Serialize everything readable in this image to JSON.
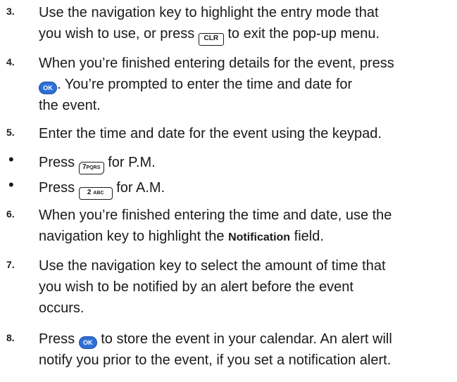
{
  "steps": [
    {
      "number": "3.",
      "line1": "Use the navigation key to highlight the entry mode that",
      "line2_pre": "you wish to use, or press ",
      "line2_key": "CLR",
      "line2_post": " to exit the pop-up menu."
    },
    {
      "number": "4.",
      "line1": "When you’re finished entering details for the event, press",
      "line2_key": "OK",
      "line2_post": ". You’re prompted to enter the time and date for",
      "line3": "the event."
    },
    {
      "number": "5.",
      "line1": "Enter the time and date for the event using the keypad."
    },
    {
      "bullet": "•",
      "pre": "Press ",
      "key_main": "7",
      "key_sub": "PQRS",
      "post": " for P.M."
    },
    {
      "bullet": "•",
      "pre": "Press ",
      "key_main": "2",
      "key_sub": "ABC",
      "post": " for A.M."
    },
    {
      "number": "6.",
      "line1": "When you’re finished entering the time and date, use the",
      "line2_pre": "navigation key to highlight the ",
      "line2_bold": "Notification",
      "line2_post": " field."
    },
    {
      "number": "7.",
      "line1": "Use the navigation key to select the amount of time that",
      "line2": "you wish to be notified by an alert before the event",
      "line3": "occurs."
    },
    {
      "number": "8.",
      "line1_pre": "Press ",
      "line1_key": "OK",
      "line1_post": " to store the event in your calendar. An alert will",
      "line2": "notify you prior to the event, if you set a notification alert."
    }
  ],
  "colors": {
    "text": "#1a1a1a",
    "ok_key": "#2f6fd6"
  }
}
